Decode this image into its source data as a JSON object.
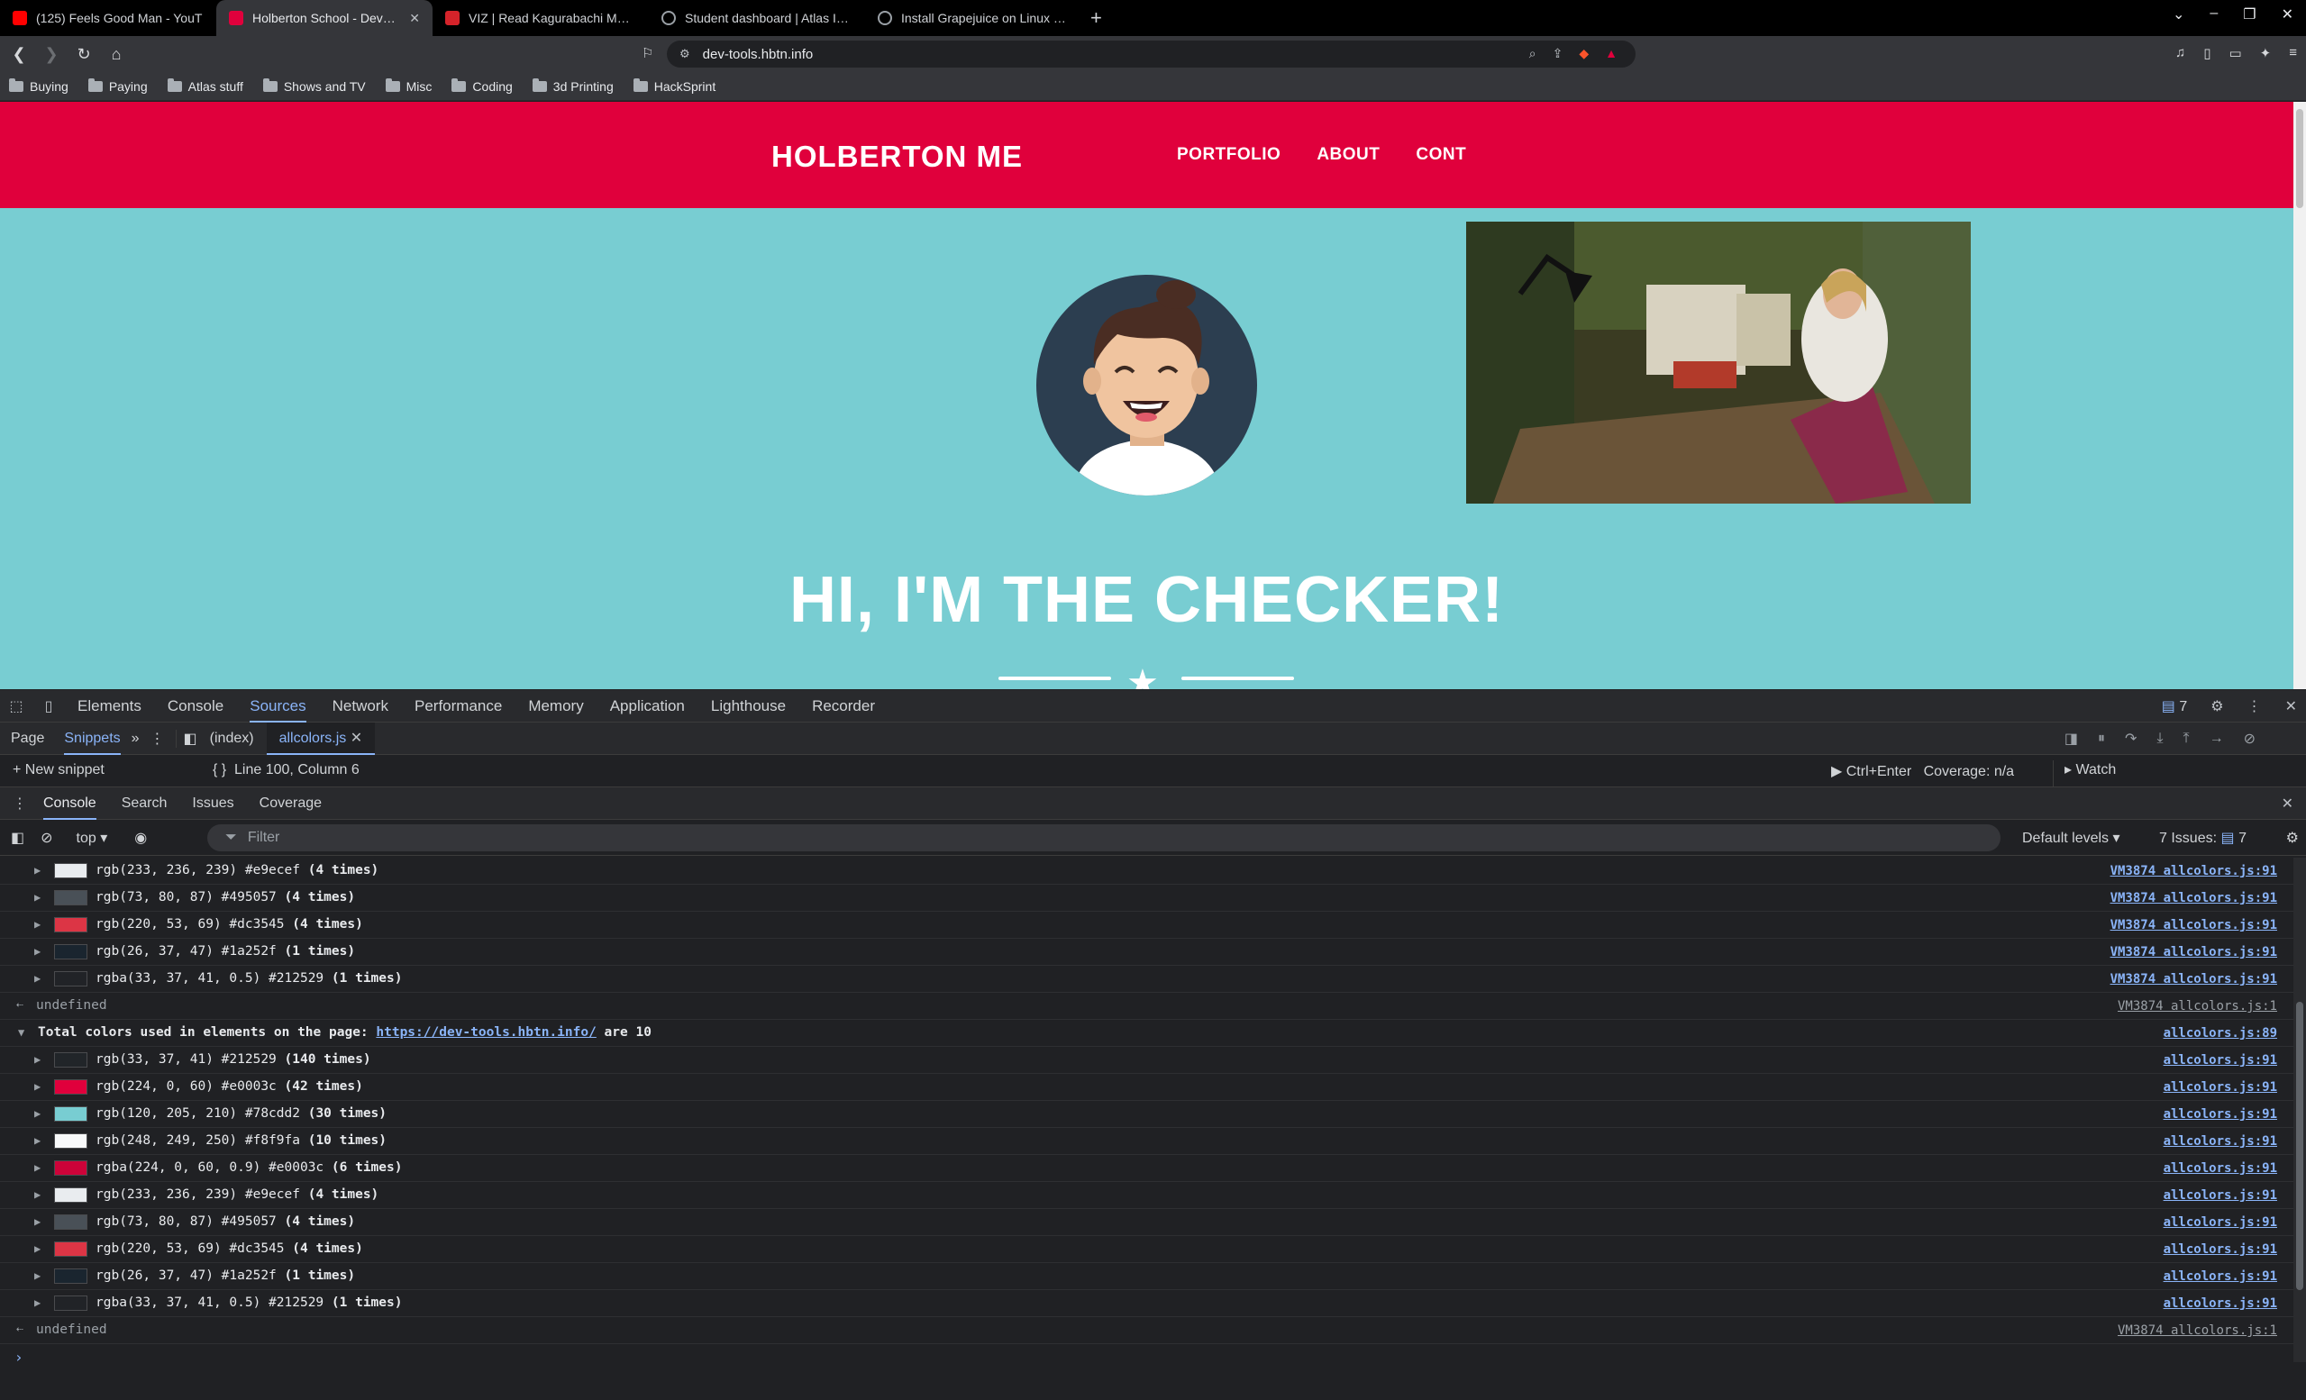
{
  "browser": {
    "tabs": [
      {
        "title": "(125) Feels Good Man - YouT",
        "fav_color": "#ff0000",
        "active": false
      },
      {
        "title": "Holberton School - Develop",
        "fav_color": "#e0003c",
        "active": true
      },
      {
        "title": "VIZ | Read Kagurabachi Manga",
        "fav_color": "#d5232a",
        "active": false
      },
      {
        "title": "Student dashboard | Atlas Intra",
        "fav_color": "#9aa0a6",
        "active": false
      },
      {
        "title": "Install Grapejuice on Linux Mint",
        "fav_color": "#9aa0a6",
        "active": false
      }
    ],
    "new_tab": "+",
    "url": "dev-tools.hbtn.info",
    "bookmarks": [
      "Buying",
      "Paying",
      "Atlas stuff",
      "Shows and TV",
      "Misc",
      "Coding",
      "3d Printing",
      "HackSprint"
    ]
  },
  "page": {
    "brand": "HOLBERTON ME",
    "nav": [
      "PORTFOLIO",
      "ABOUT",
      "CONT"
    ],
    "hero_title": "HI, I'M THE CHECKER!",
    "colors": {
      "navbar": "#e0003c",
      "hero_bg": "#78cdd2",
      "avatar_bg": "#2c3e50"
    }
  },
  "devtools": {
    "tabs": [
      "Elements",
      "Console",
      "Sources",
      "Network",
      "Performance",
      "Memory",
      "Application",
      "Lighthouse",
      "Recorder"
    ],
    "active_tab": "Sources",
    "issues_badge": "7",
    "sources": {
      "nav_page": "Page",
      "nav_snippets": "Snippets",
      "files": [
        "(index)",
        "allcolors.js"
      ],
      "new_snippet": "New snippet",
      "cursor": "Line 100, Column 6",
      "run_hint": "Ctrl+Enter",
      "coverage": "Coverage: n/a",
      "watch": "Watch"
    },
    "drawer_tabs": [
      "Console",
      "Search",
      "Issues",
      "Coverage"
    ],
    "active_drawer": "Console",
    "console": {
      "context": "top",
      "filter_placeholder": "Filter",
      "levels": "Default levels",
      "issues": "7 Issues:",
      "issues_count": "7"
    },
    "first_rows": [
      {
        "swatch": "#e9ecef",
        "text": "rgb(233, 236, 239) #e9ecef",
        "count": "(4 times)",
        "link": "VM3874 allcolors.js:91"
      },
      {
        "swatch": "#495057",
        "text": "rgb(73, 80, 87) #495057",
        "count": "(4 times)",
        "link": "VM3874 allcolors.js:91"
      },
      {
        "swatch": "#dc3545",
        "text": "rgb(220, 53, 69) #dc3545",
        "count": "(4 times)",
        "link": "VM3874 allcolors.js:91"
      },
      {
        "swatch": "#1a252f",
        "text": "rgb(26, 37, 47) #1a252f",
        "count": "(1 times)",
        "link": "VM3874 allcolors.js:91"
      },
      {
        "swatch": "rgba(33,37,41,0.5)",
        "text": "rgba(33, 37, 41, 0.5) #212529",
        "count": "(1 times)",
        "link": "VM3874 allcolors.js:91"
      }
    ],
    "undefined_1": {
      "text": "undefined",
      "link": "VM3874 allcolors.js:1"
    },
    "group": {
      "prefix": "Total colors used in elements on the page: ",
      "url": "https://dev-tools.hbtn.info/",
      "suffix": " are 10",
      "link": "allcolors.js:89"
    },
    "rows": [
      {
        "swatch": "#212529",
        "text": "rgb(33, 37, 41) #212529",
        "count": "(140 times)",
        "link": "allcolors.js:91"
      },
      {
        "swatch": "#e0003c",
        "text": "rgb(224, 0, 60) #e0003c",
        "count": "(42 times)",
        "link": "allcolors.js:91"
      },
      {
        "swatch": "#78cdd2",
        "text": "rgb(120, 205, 210) #78cdd2",
        "count": "(30 times)",
        "link": "allcolors.js:91"
      },
      {
        "swatch": "#f8f9fa",
        "text": "rgb(248, 249, 250) #f8f9fa",
        "count": "(10 times)",
        "link": "allcolors.js:91"
      },
      {
        "swatch": "rgba(224,0,60,0.9)",
        "text": "rgba(224, 0, 60, 0.9) #e0003c",
        "count": "(6 times)",
        "link": "allcolors.js:91"
      },
      {
        "swatch": "#e9ecef",
        "text": "rgb(233, 236, 239) #e9ecef",
        "count": "(4 times)",
        "link": "allcolors.js:91"
      },
      {
        "swatch": "#495057",
        "text": "rgb(73, 80, 87) #495057",
        "count": "(4 times)",
        "link": "allcolors.js:91"
      },
      {
        "swatch": "#dc3545",
        "text": "rgb(220, 53, 69) #dc3545",
        "count": "(4 times)",
        "link": "allcolors.js:91"
      },
      {
        "swatch": "#1a252f",
        "text": "rgb(26, 37, 47) #1a252f",
        "count": "(1 times)",
        "link": "allcolors.js:91"
      },
      {
        "swatch": "rgba(33,37,41,0.5)",
        "text": "rgba(33, 37, 41, 0.5) #212529",
        "count": "(1 times)",
        "link": "allcolors.js:91"
      }
    ],
    "undefined_2": {
      "text": "undefined",
      "link": "VM3874 allcolors.js:1"
    }
  }
}
